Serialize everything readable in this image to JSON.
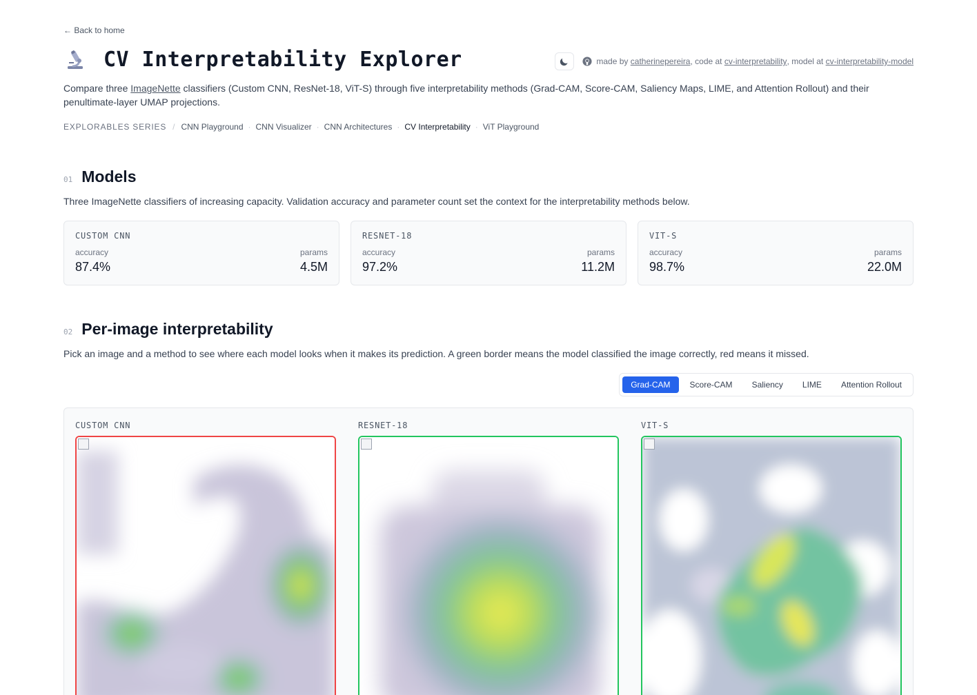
{
  "back_link": "← Back to home",
  "title": "CV Interpretability Explorer",
  "credits": {
    "made_by": "made by",
    "author": "catherinepereira",
    "code_at": ", code at",
    "code_repo": "cv-interpretability",
    "model_at": ", model at",
    "model_repo": "cv-interpretability-model"
  },
  "intro": {
    "before": "Compare three",
    "link": "ImageNette",
    "after": "classifiers (Custom CNN, ResNet-18, ViT-S) through five interpretability methods (Grad-CAM, Score-CAM, Saliency Maps, LIME, and Attention Rollout) and their penultimate-layer UMAP projections."
  },
  "series": {
    "label": "EXPLORABLES SERIES",
    "items": [
      "CNN Playground",
      "CNN Visualizer",
      "CNN Architectures",
      "CV Interpretability",
      "ViT Playground"
    ],
    "active": "CV Interpretability"
  },
  "section1": {
    "num": "01",
    "title": "Models",
    "desc": "Three ImageNette classifiers of increasing capacity. Validation accuracy and parameter count set the context for the interpretability methods below."
  },
  "models": [
    {
      "name": "CUSTOM CNN",
      "acc_label": "accuracy",
      "acc": "87.4%",
      "params_label": "params",
      "params": "4.5M"
    },
    {
      "name": "RESNET-18",
      "acc_label": "accuracy",
      "acc": "97.2%",
      "params_label": "params",
      "params": "11.2M"
    },
    {
      "name": "VIT-S",
      "acc_label": "accuracy",
      "acc": "98.7%",
      "params_label": "params",
      "params": "22.0M"
    }
  ],
  "section2": {
    "num": "02",
    "title": "Per-image interpretability",
    "desc": "Pick an image and a method to see where each model looks when it makes its prediction. A green border means the model classified the image correctly, red means it missed."
  },
  "methods": [
    "Grad-CAM",
    "Score-CAM",
    "Saliency",
    "LIME",
    "Attention Rollout"
  ],
  "active_method": "Grad-CAM",
  "results": [
    {
      "name": "CUSTOM CNN",
      "correct": false
    },
    {
      "name": "RESNET-18",
      "correct": true
    },
    {
      "name": "VIT-S",
      "correct": true
    }
  ],
  "colors": {
    "accent": "#2563eb",
    "correct": "#22c55e",
    "incorrect": "#ef4444"
  }
}
